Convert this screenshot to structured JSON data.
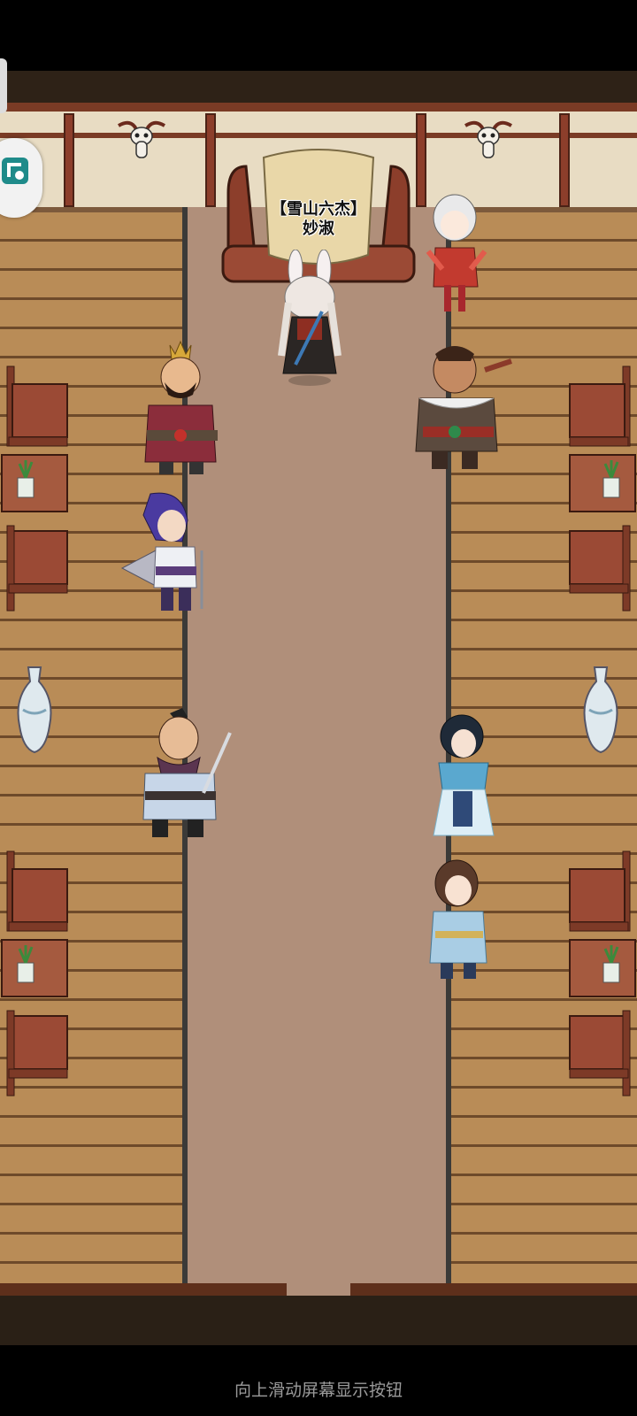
{
  "scene": {
    "boss": {
      "title": "【雪山六杰】",
      "name": "妙淑"
    },
    "characters": [
      {
        "id": "boss",
        "icon": "rabbit-ear-swordswoman-icon"
      },
      {
        "id": "right-top",
        "icon": "white-hair-warrior-icon"
      },
      {
        "id": "left-1",
        "icon": "crowned-general-icon"
      },
      {
        "id": "right-1",
        "icon": "bandit-chief-icon"
      },
      {
        "id": "left-2",
        "icon": "purple-hair-swordsman-icon"
      },
      {
        "id": "left-3",
        "icon": "scarf-swordsman-icon"
      },
      {
        "id": "right-2",
        "icon": "blue-robe-lady-icon"
      },
      {
        "id": "right-3",
        "icon": "young-maiden-icon"
      }
    ],
    "colors": {
      "carpet": "#b08f7a",
      "floor": "#b98c57",
      "wall": "#e8dcc3",
      "trim": "#7a3b25"
    }
  },
  "system": {
    "nav_hint": "向上滑动屏幕显示按钮"
  }
}
